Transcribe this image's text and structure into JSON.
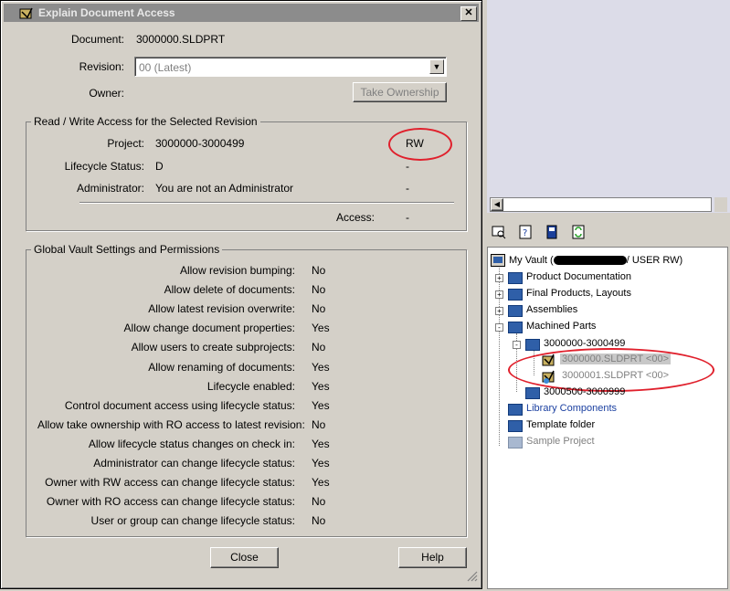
{
  "dialog": {
    "title": "Explain Document Access",
    "document_label": "Document:",
    "document_value": "3000000.SLDPRT",
    "revision_label": "Revision:",
    "revision_value": "00 (Latest)",
    "owner_label": "Owner:",
    "take_ownership_label": "Take Ownership",
    "rw_group": {
      "title": "Read / Write Access for the Selected Revision",
      "rows": [
        {
          "label": "Project:",
          "value": "3000000-3000499",
          "access": "RW"
        },
        {
          "label": "Lifecycle Status:",
          "value": "D",
          "access": "-"
        },
        {
          "label": "Administrator:",
          "value": "You are not an Administrator",
          "access": "-"
        }
      ],
      "access_label": "Access:",
      "access_value": "-"
    },
    "global_group": {
      "title": "Global Vault Settings and Permissions",
      "rows": [
        {
          "label": "Allow revision bumping:",
          "value": "No"
        },
        {
          "label": "Allow delete of documents:",
          "value": "No"
        },
        {
          "label": "Allow latest revision overwrite:",
          "value": "No"
        },
        {
          "label": "Allow change document properties:",
          "value": "Yes"
        },
        {
          "label": "Allow users to create subprojects:",
          "value": "No"
        },
        {
          "label": "Allow renaming of documents:",
          "value": "Yes"
        },
        {
          "label": "Lifecycle enabled:",
          "value": "Yes"
        },
        {
          "label": "Control document access using lifecycle status:",
          "value": "Yes"
        },
        {
          "label": "Allow take ownership with RO access to latest revision:",
          "value": "No"
        },
        {
          "label": "Allow lifecycle status changes on check in:",
          "value": "Yes"
        },
        {
          "label": "Administrator can change lifecycle status:",
          "value": "Yes"
        },
        {
          "label": "Owner with RW access can change lifecycle status:",
          "value": "Yes"
        },
        {
          "label": "Owner with RO access can change lifecycle status:",
          "value": "No"
        },
        {
          "label": "User or group can change lifecycle status:",
          "value": "No"
        }
      ]
    },
    "close_label": "Close",
    "help_label": "Help"
  },
  "tree": {
    "root": {
      "label_prefix": "My Vault (",
      "label_suffix": "/ USER RW)"
    },
    "items": [
      {
        "label": "Product Documentation",
        "expander": "+"
      },
      {
        "label": "Final Products, Layouts",
        "expander": "+"
      },
      {
        "label": "Assemblies",
        "expander": "+"
      },
      {
        "label": "Machined Parts",
        "expander": "-"
      }
    ],
    "subproject": {
      "label": "3000000-3000499",
      "expander": "-"
    },
    "files": [
      {
        "label": "3000000.SLDPRT <00>"
      },
      {
        "label": "3000001.SLDPRT <00>"
      }
    ],
    "after": [
      {
        "label": "3000500-3000999"
      },
      {
        "label": "Library Components"
      },
      {
        "label": "Template folder"
      },
      {
        "label": "Sample Project"
      }
    ]
  },
  "toolbar_icons": [
    "view-icon",
    "help-icon",
    "card-icon",
    "refresh-icon"
  ],
  "colors": {
    "annotation_red": "#e0202c",
    "folder_blue": "#2f5fa8",
    "titlebar_gray": "#8c8c8c"
  }
}
